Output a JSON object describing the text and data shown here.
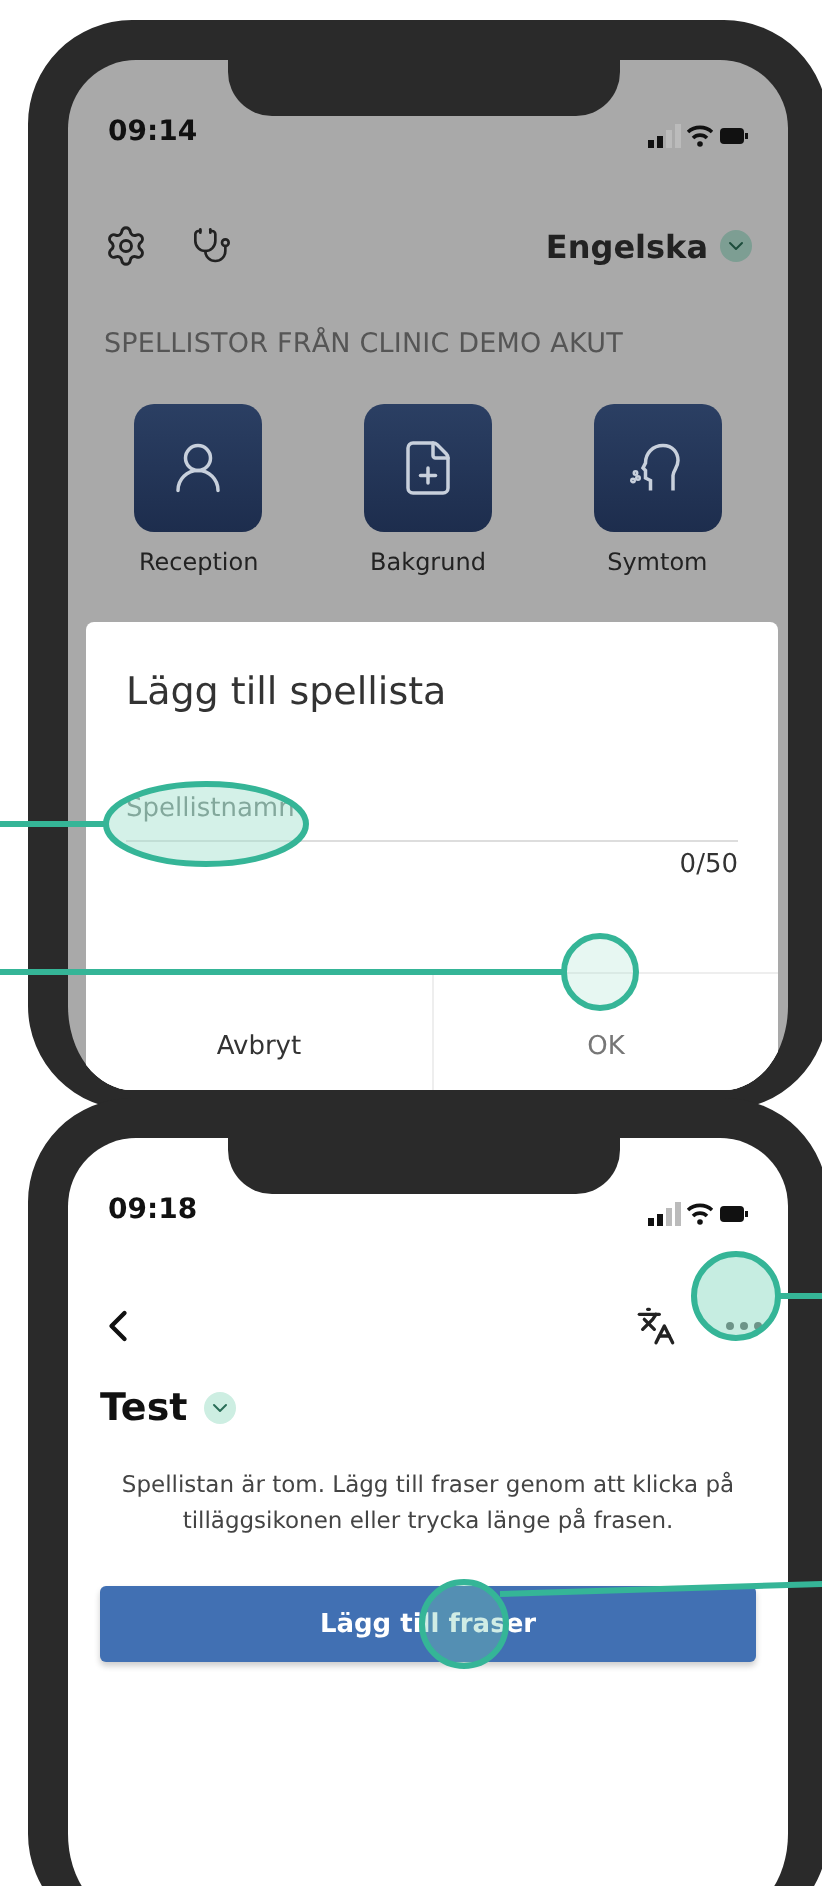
{
  "phone_1": {
    "status_bar": {
      "time": "09:14"
    },
    "language": "Engelska",
    "section_title": "SPELLISTOR FRÅN CLINIC DEMO AKUT",
    "categories": [
      {
        "label": "Reception",
        "kind": "reception"
      },
      {
        "label": "Bakgrund",
        "kind": "background"
      },
      {
        "label": "Symtom",
        "kind": "symptom"
      }
    ],
    "dialog": {
      "title": "Lägg till spellista",
      "field": {
        "placeholder": "Spellistnamn"
      },
      "counter": "0/50",
      "buttons": [
        {
          "label": "Avbryt",
          "disabled": false
        },
        {
          "label": "OK",
          "disabled": true
        }
      ]
    }
  },
  "phone_2": {
    "status_bar": {
      "time": "09:18"
    },
    "playlist_title": "Test",
    "empty_message": "Spellistan är tom. Lägg till fraser genom att klicka på tilläggsikonen eller trycka länge på frasen.",
    "add_button": "Lägg till fraser"
  }
}
